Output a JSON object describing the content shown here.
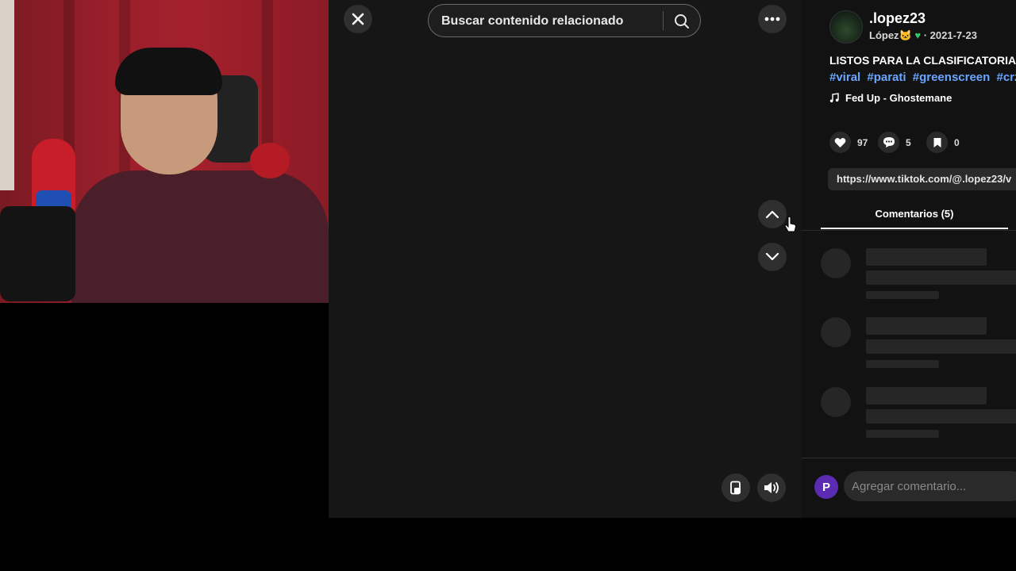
{
  "search": {
    "placeholder": "Buscar contenido relacionado"
  },
  "post": {
    "username": ".lopez23",
    "display_name": "López",
    "date": "2021-7-23",
    "caption": "LISTOS PARA LA CLASIFICATORIA",
    "hashtags": [
      "#viral",
      "#parati",
      "#greenscreen",
      "#crz"
    ],
    "music": "Fed Up - Ghostemane",
    "likes": "97",
    "comments": "5",
    "saves": "0",
    "link": "https://www.tiktok.com/@.lopez23/v"
  },
  "comments_tab": {
    "label": "Comentarios (5)"
  },
  "comment_box": {
    "avatar_letter": "P",
    "placeholder": "Agregar comentario..."
  },
  "colors": {
    "accent_link": "#6aa6ff",
    "avatar_purple": "#5b2bb3",
    "panel_bg": "#121212",
    "viewer_bg": "#161616"
  }
}
